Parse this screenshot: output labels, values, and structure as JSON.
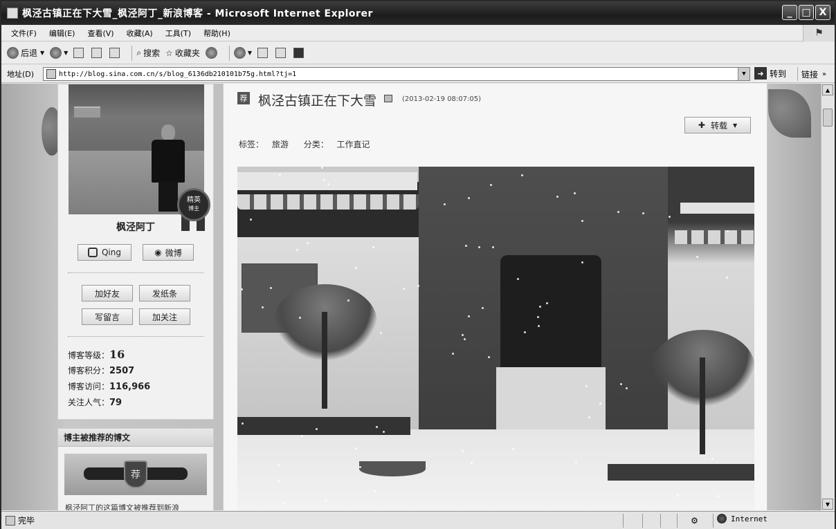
{
  "window": {
    "title": "枫泾古镇正在下大雪_枫泾阿丁_新浪博客 - Microsoft Internet Explorer",
    "minimize": "_",
    "maximize": "□",
    "close": "X"
  },
  "menu": [
    "文件(F)",
    "编辑(E)",
    "查看(V)",
    "收藏(A)",
    "工具(T)",
    "帮助(H)"
  ],
  "toolbar": {
    "back": "后退",
    "search": "搜索",
    "favorites": "收藏夹"
  },
  "address": {
    "label": "地址(D)",
    "url": "http://blog.sina.com.cn/s/blog_6136db210101b75g.html?tj=1",
    "go": "转到",
    "links": "链接"
  },
  "sidebar": {
    "badge_top": "精英",
    "badge_bottom": "博主",
    "username": "枫泾阿丁",
    "qing_label": "Qing",
    "weibo_label": "微博",
    "add_friend": "加好友",
    "send_note": "发纸条",
    "write_message": "写留言",
    "follow": "加关注",
    "stats": {
      "level_label": "博客等级：",
      "level_value": "16",
      "points_label": "博客积分：",
      "points_value": "2507",
      "visits_label": "博客访问：",
      "visits_value": "116,966",
      "popularity_label": "关注人气：",
      "popularity_value": "79"
    }
  },
  "recommended": {
    "heading": "博主被推荐的博文",
    "badge": "荐",
    "snippet": "枫泾阿丁的这篇博文被推荐到新浪"
  },
  "post": {
    "rec_icon": "荐",
    "title": "枫泾古镇正在下大雪",
    "date": "(2013-02-19 08:07:05)",
    "repost": "转载",
    "tags_label": "标签：",
    "tags_value": "旅游",
    "category_label": "分类：",
    "category_value": "工作直记"
  },
  "status": {
    "text": "完毕",
    "zone": "Internet"
  }
}
